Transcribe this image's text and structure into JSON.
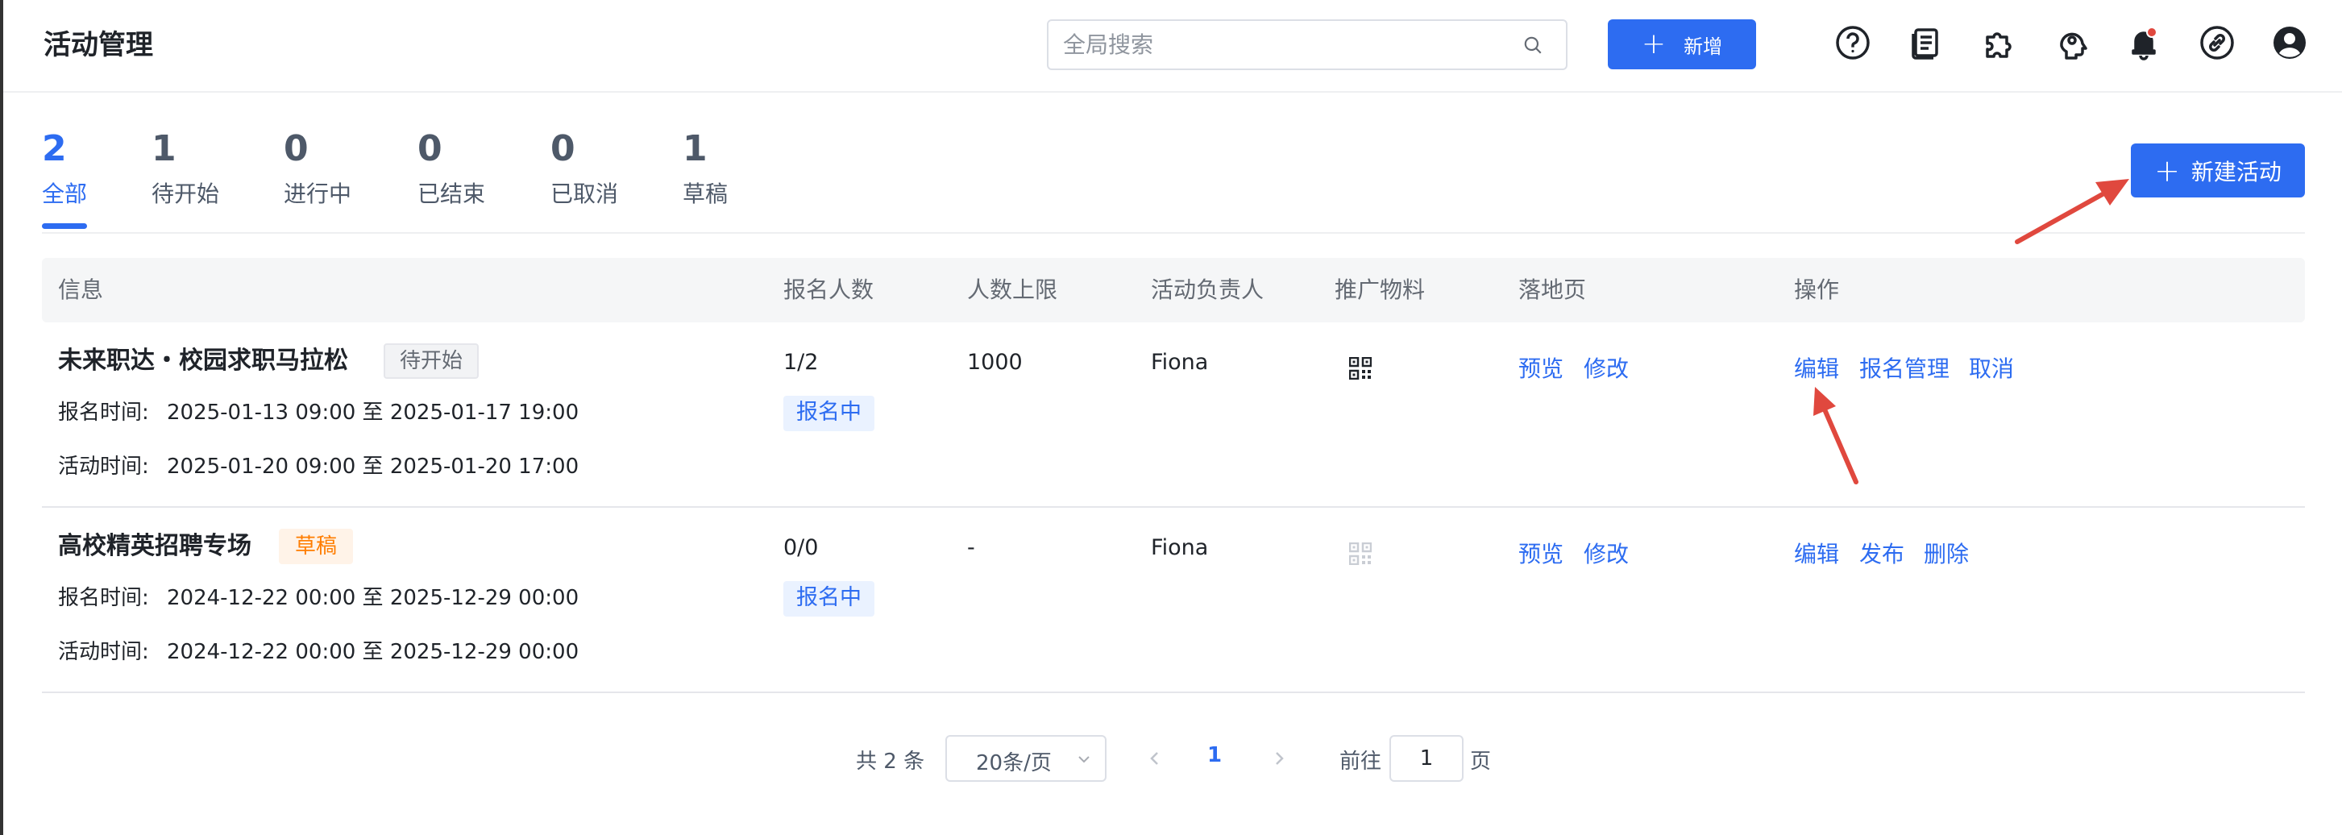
{
  "header": {
    "title": "活动管理",
    "search_placeholder": "全局搜索",
    "add_label": "新增",
    "icons": [
      "help-icon",
      "document-icon",
      "plugin-icon",
      "support-icon",
      "notification-bell-icon",
      "link-icon",
      "user-avatar-icon"
    ]
  },
  "tabs": [
    {
      "count": "2",
      "label": "全部",
      "active": true
    },
    {
      "count": "1",
      "label": "待开始"
    },
    {
      "count": "0",
      "label": "进行中"
    },
    {
      "count": "0",
      "label": "已结束"
    },
    {
      "count": "0",
      "label": "已取消"
    },
    {
      "count": "1",
      "label": "草稿"
    }
  ],
  "new_activity_label": "新建活动",
  "table": {
    "columns": [
      "信息",
      "报名人数",
      "人数上限",
      "活动负责人",
      "推广物料",
      "落地页",
      "操作"
    ],
    "rows": [
      {
        "name": "未来职达・校园求职马拉松",
        "status": "待开始",
        "reg_time_label": "报名时间:",
        "reg_time": "2025-01-13 09:00 至 2025-01-17 19:00",
        "act_time_label": "活动时间:",
        "act_time": "2025-01-20 09:00 至 2025-01-20 17:00",
        "signup_count": "1/2",
        "signup_status": "报名中",
        "limit": "1000",
        "owner": "Fiona",
        "promo": "qr-code-icon",
        "landing": [
          "预览",
          "修改"
        ],
        "ops": [
          "编辑",
          "报名管理",
          "取消"
        ]
      },
      {
        "name": "高校精英招聘专场",
        "status": "草稿",
        "reg_time_label": "报名时间:",
        "reg_time": "2024-12-22 00:00 至 2025-12-29 00:00",
        "act_time_label": "活动时间:",
        "act_time": "2024-12-22 00:00 至 2025-12-29 00:00",
        "signup_count": "0/0",
        "signup_status": "报名中",
        "limit": "-",
        "owner": "Fiona",
        "promo": "qr-code-icon",
        "landing": [
          "预览",
          "修改"
        ],
        "ops": [
          "编辑",
          "发布",
          "删除"
        ]
      }
    ]
  },
  "pagination": {
    "total": "共 2 条",
    "page_size": "20条/页",
    "current_page": "1",
    "goto_prefix": "前往",
    "goto_value": "1",
    "goto_suffix": "页"
  },
  "colors": {
    "accent": "#2d6cf1",
    "annotation_arrow": "#e0483e",
    "draft_tag": "#ff7d00"
  }
}
